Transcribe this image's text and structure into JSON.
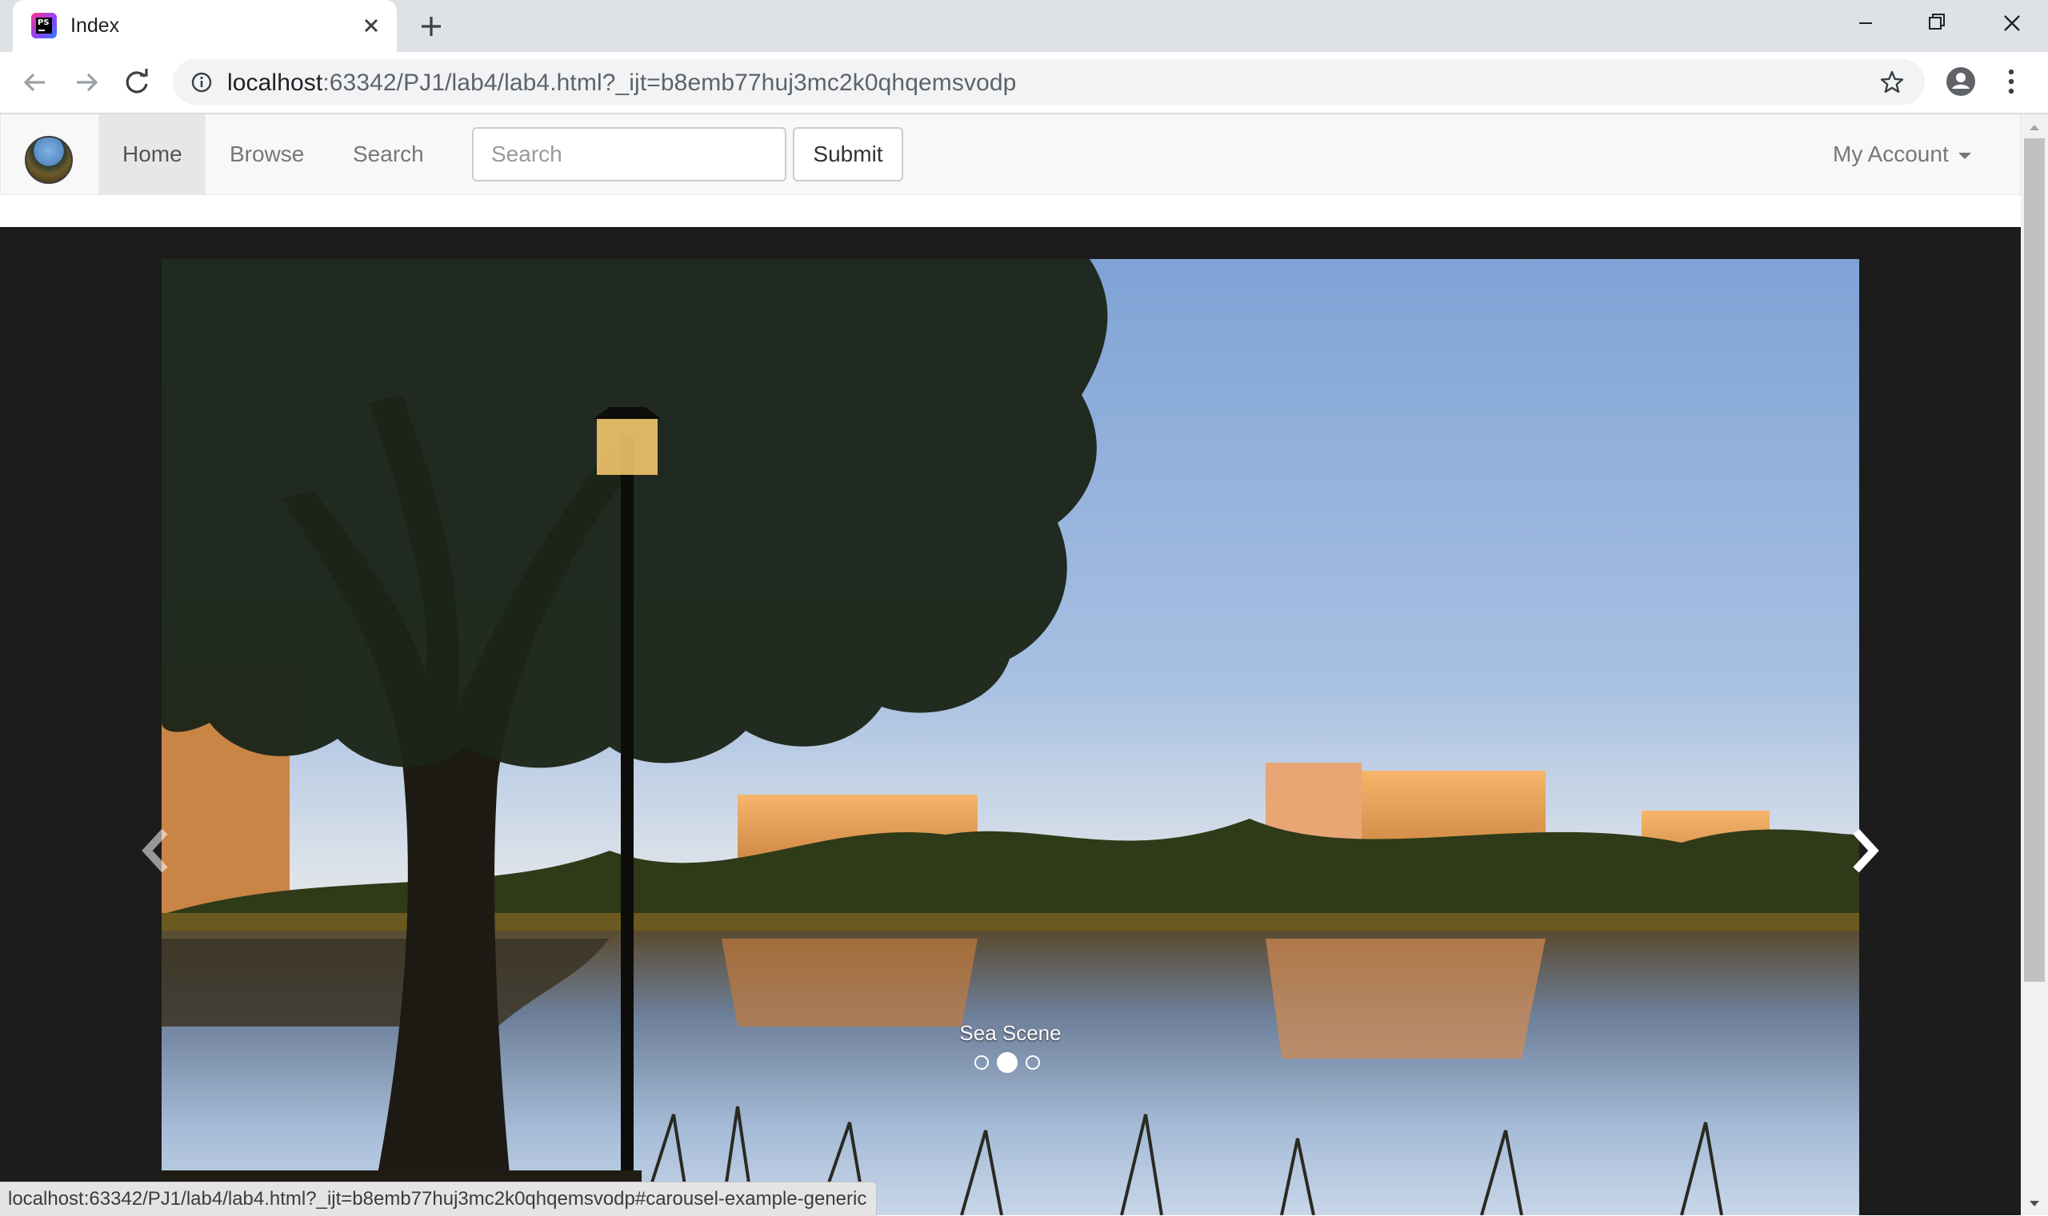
{
  "browser": {
    "tab_title": "Index",
    "url_host": "localhost",
    "url_rest": ":63342/PJ1/lab4/lab4.html?_ijt=b8emb77huj3mc2k0qhqemsvodp",
    "status_url": "localhost:63342/PJ1/lab4/lab4.html?_ijt=b8emb77huj3mc2k0qhqemsvodp#carousel-example-generic"
  },
  "navbar": {
    "items": [
      {
        "label": "Home",
        "active": true
      },
      {
        "label": "Browse",
        "active": false
      },
      {
        "label": "Search",
        "active": false
      }
    ],
    "search_placeholder": "Search",
    "submit_label": "Submit",
    "account_label": "My Account"
  },
  "carousel": {
    "caption": "Sea Scene",
    "slide_count": 3,
    "active_index": 1
  },
  "colors": {
    "navbar_bg": "#f8f8f8",
    "carousel_bg": "#1c1c1c",
    "tabstrip_bg": "#dee1e6"
  },
  "icons": [
    "phpstorm-favicon",
    "close-icon",
    "plus-icon",
    "minimize-icon",
    "restore-icon",
    "window-close-icon",
    "back-arrow-icon",
    "forward-arrow-icon",
    "reload-icon",
    "info-icon",
    "star-icon",
    "profile-icon",
    "more-vert-icon",
    "chevron-left-icon",
    "chevron-right-icon"
  ]
}
